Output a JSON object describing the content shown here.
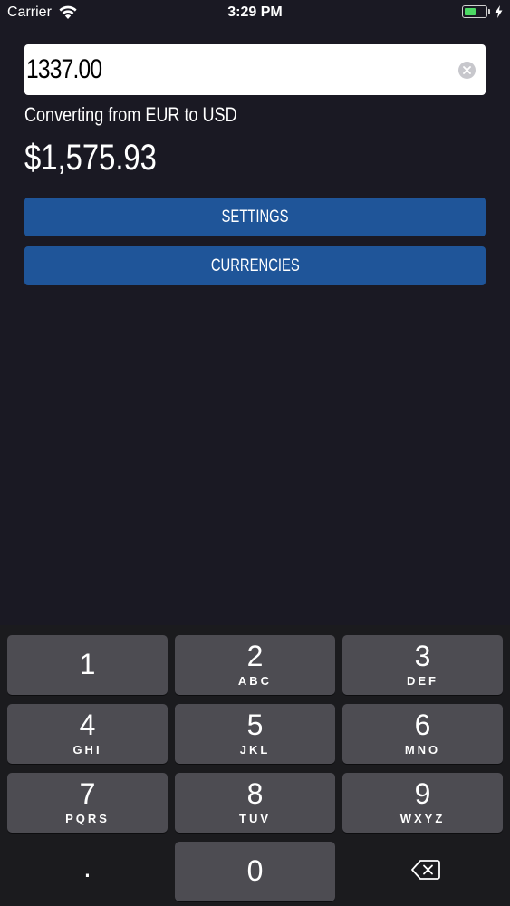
{
  "status_bar": {
    "carrier": "Carrier",
    "time": "3:29 PM"
  },
  "converter": {
    "amount_value": "1337.00",
    "conversion_label": "Converting from EUR to USD",
    "result_value": "$1,575.93"
  },
  "buttons": {
    "settings_label": "SETTINGS",
    "currencies_label": "CURRENCIES"
  },
  "keypad": {
    "keys": [
      {
        "digit": "1",
        "letters": ""
      },
      {
        "digit": "2",
        "letters": "ABC"
      },
      {
        "digit": "3",
        "letters": "DEF"
      },
      {
        "digit": "4",
        "letters": "GHI"
      },
      {
        "digit": "5",
        "letters": "JKL"
      },
      {
        "digit": "6",
        "letters": "MNO"
      },
      {
        "digit": "7",
        "letters": "PQRS"
      },
      {
        "digit": "8",
        "letters": "TUV"
      },
      {
        "digit": "9",
        "letters": "WXYZ"
      }
    ],
    "decimal": ".",
    "zero": "0"
  },
  "colors": {
    "background": "#1a1923",
    "button_accent": "#1f5599",
    "key_background": "#4d4c52",
    "battery": "#4cd964"
  },
  "icons": [
    "wifi-icon",
    "battery-icon",
    "charging-bolt-icon",
    "clear-icon",
    "backspace-icon"
  ]
}
